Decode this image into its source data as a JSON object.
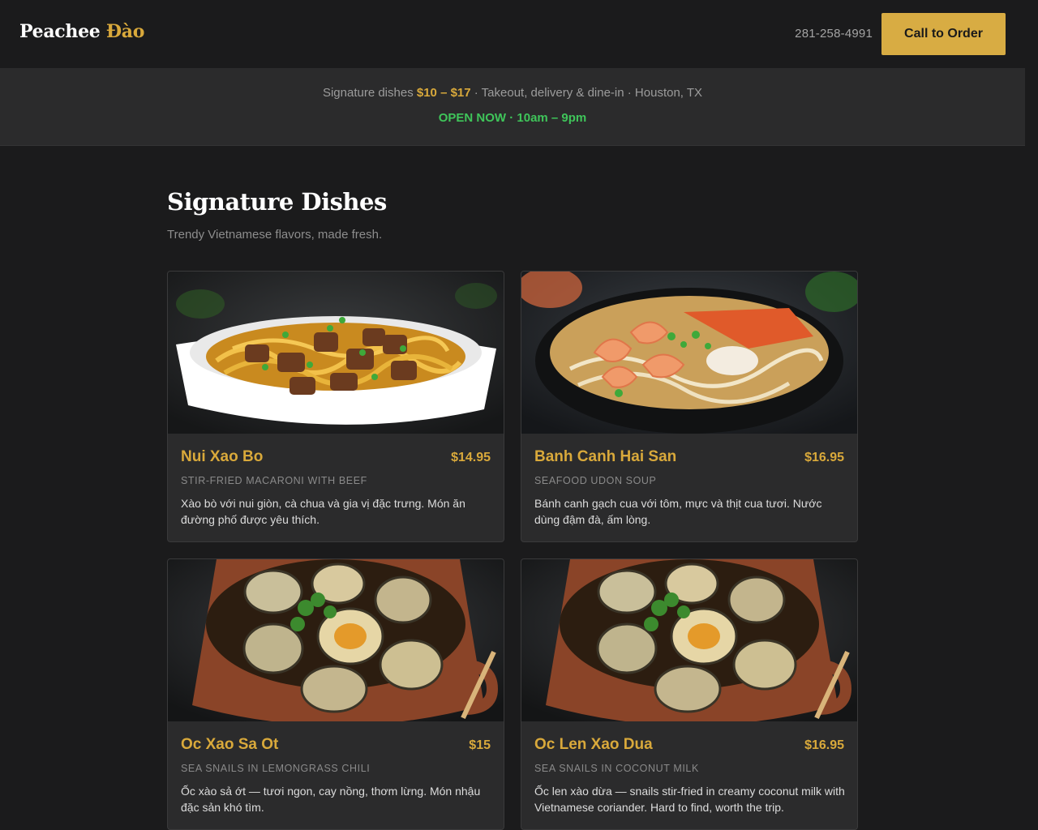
{
  "header": {
    "logo_main": "Peachee",
    "logo_accent": "Đào",
    "phone": "281-258-4991",
    "call_label": "Call to Order"
  },
  "info_bar": {
    "prefix": "Signature dishes",
    "price_range": "$10 – $17",
    "suffix": "· Takeout, delivery & dine-in · Houston, TX",
    "open_status": "OPEN NOW · 10am – 9pm"
  },
  "section": {
    "title": "Signature Dishes",
    "subtitle": "Trendy Vietnamese flavors, made fresh."
  },
  "dishes": [
    {
      "name": "Nui Xao Bo",
      "price": "$14.95",
      "subtitle": "STIR-FRIED MACARONI WITH BEEF",
      "description": "Xào bò với nui giòn, cà chua và gia vị đặc trưng. Món ăn đường phố được yêu thích.",
      "image_icon": "beef-noodle-bowl-photo"
    },
    {
      "name": "Banh Canh Hai San",
      "price": "$16.95",
      "subtitle": "SEAFOOD UDON SOUP",
      "description": "Bánh canh gạch cua với tôm, mực và thịt cua tươi. Nước dùng đậm đà, ấm lòng.",
      "image_icon": "seafood-soup-bowl-photo"
    },
    {
      "name": "Oc Xao Sa Ot",
      "price": "$15",
      "subtitle": "SEA SNAILS IN LEMONGRASS CHILI",
      "description": "Ốc xào sả ớt — tươi ngon, cay nồng, thơm lừng. Món nhậu đặc sản khó tìm.",
      "image_icon": "snail-clay-pot-photo"
    },
    {
      "name": "Oc Len Xao Dua",
      "price": "$16.95",
      "subtitle": "SEA SNAILS IN COCONUT MILK",
      "description": "Ốc len xào dừa — snails stir-fried in creamy coconut milk with Vietnamese coriander. Hard to find, worth the trip.",
      "image_icon": "snail-clay-pot-photo"
    }
  ],
  "colors": {
    "background": "#1b1b1c",
    "panel": "#2b2b2c",
    "accent_gold": "#d9a93b",
    "open_green": "#3fc55a"
  }
}
